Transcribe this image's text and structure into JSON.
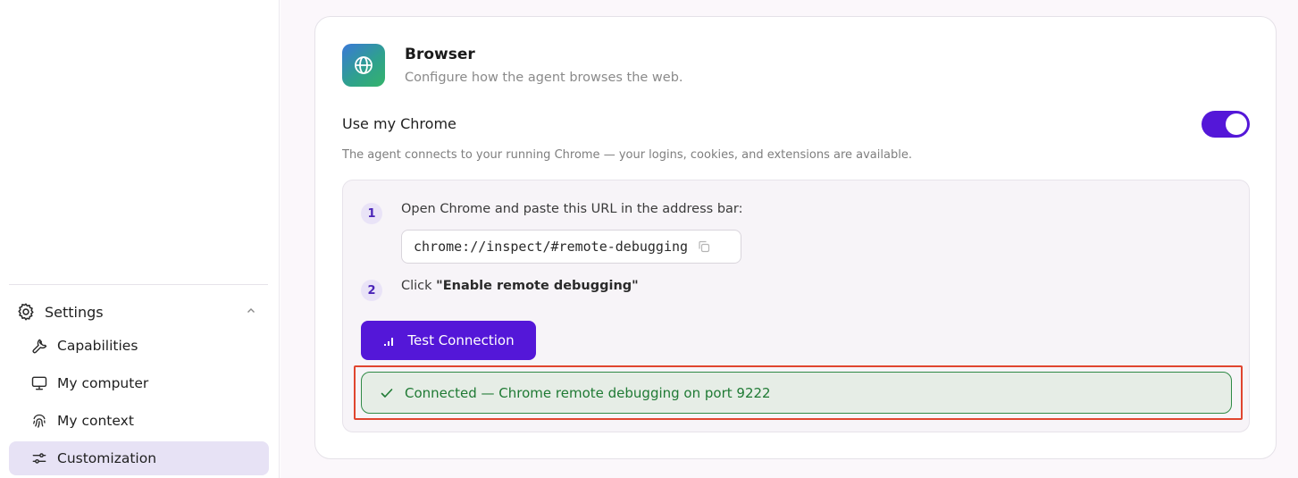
{
  "sidebar": {
    "settings_label": "Settings",
    "items": [
      {
        "label": "Capabilities",
        "icon": "wrench-icon"
      },
      {
        "label": "My computer",
        "icon": "monitor-icon"
      },
      {
        "label": "My context",
        "icon": "fingerprint-icon"
      },
      {
        "label": "Customization",
        "icon": "sliders-icon",
        "active": true
      }
    ]
  },
  "browser": {
    "title": "Browser",
    "subtitle": "Configure how the agent browses the web.",
    "icon": "globe-icon",
    "use_chrome_label": "Use my Chrome",
    "use_chrome_enabled": true,
    "description": "The agent connects to your running Chrome — your logins, cookies, and extensions are available.",
    "steps": [
      {
        "num": "1",
        "text": "Open Chrome and paste this URL in the address bar:"
      },
      {
        "num": "2",
        "prefix": "Click ",
        "bold": "\"Enable remote debugging\""
      }
    ],
    "url": "chrome://inspect/#remote-debugging",
    "test_button_label": "Test Connection",
    "status_text": "Connected — Chrome remote debugging on port 9222"
  },
  "colors": {
    "accent": "#5417d8",
    "success": "#1f7a34",
    "highlight": "#e0452f",
    "active_nav": "#e7e2f5"
  }
}
